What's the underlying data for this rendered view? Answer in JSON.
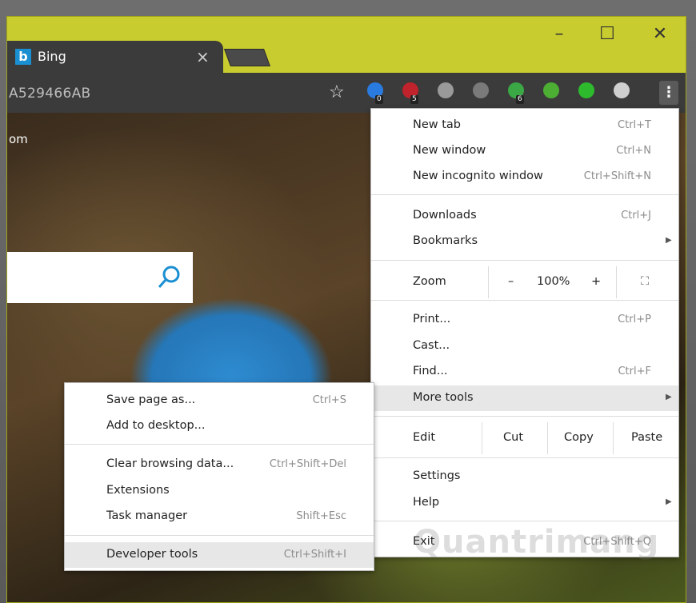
{
  "window": {
    "tab_title": "Bing",
    "tab_favicon": "b",
    "close_tab_glyph": "×",
    "controls": {
      "minimize": "–",
      "maximize": "☐",
      "close": "✕"
    }
  },
  "toolbar": {
    "url": "A529466AB",
    "bookmark_star": "☆",
    "menu_glyph": "⋮",
    "extensions": [
      {
        "name": "extension-ghost-icon",
        "color": "#2a7be0",
        "badge": "0"
      },
      {
        "name": "extension-shield-icon",
        "color": "#c0232b",
        "badge": "5"
      },
      {
        "name": "extension-globe-icon",
        "color": "#9a9a9a",
        "badge": ""
      },
      {
        "name": "extension-download-gray-icon",
        "color": "#7a7a7a",
        "badge": ""
      },
      {
        "name": "extension-check-shield-icon",
        "color": "#3aa845",
        "badge": "6"
      },
      {
        "name": "extension-download-green-icon",
        "color": "#4caf34",
        "badge": ""
      },
      {
        "name": "extension-ring-icon",
        "color": "#2dbb2d",
        "badge": ""
      },
      {
        "name": "extension-cloud-icon",
        "color": "#cfcfcf",
        "badge": ""
      }
    ]
  },
  "content": {
    "partial_text": "om"
  },
  "main_menu": {
    "new_tab": {
      "label": "New tab",
      "shortcut": "Ctrl+T"
    },
    "new_window": {
      "label": "New window",
      "shortcut": "Ctrl+N"
    },
    "new_incognito": {
      "label": "New incognito window",
      "shortcut": "Ctrl+Shift+N"
    },
    "downloads": {
      "label": "Downloads",
      "shortcut": "Ctrl+J"
    },
    "bookmarks": {
      "label": "Bookmarks"
    },
    "zoom": {
      "label": "Zoom",
      "minus": "–",
      "value": "100%",
      "plus": "+",
      "fullscreen": "⛶"
    },
    "print": {
      "label": "Print...",
      "shortcut": "Ctrl+P"
    },
    "cast": {
      "label": "Cast..."
    },
    "find": {
      "label": "Find...",
      "shortcut": "Ctrl+F"
    },
    "more_tools": {
      "label": "More tools"
    },
    "edit": {
      "label": "Edit",
      "cut": "Cut",
      "copy": "Copy",
      "paste": "Paste"
    },
    "settings": {
      "label": "Settings"
    },
    "help": {
      "label": "Help"
    },
    "exit": {
      "label": "Exit",
      "shortcut": "Ctrl+Shift+Q"
    },
    "submenu_arrow": "▶"
  },
  "more_tools_menu": {
    "save_page": {
      "label": "Save page as...",
      "shortcut": "Ctrl+S"
    },
    "add_to_desktop": {
      "label": "Add to desktop..."
    },
    "clear_browsing": {
      "label": "Clear browsing data...",
      "shortcut": "Ctrl+Shift+Del"
    },
    "extensions": {
      "label": "Extensions"
    },
    "task_manager": {
      "label": "Task manager",
      "shortcut": "Shift+Esc"
    },
    "developer_tools": {
      "label": "Developer tools",
      "shortcut": "Ctrl+Shift+I"
    }
  },
  "watermark": "Quantrimang"
}
